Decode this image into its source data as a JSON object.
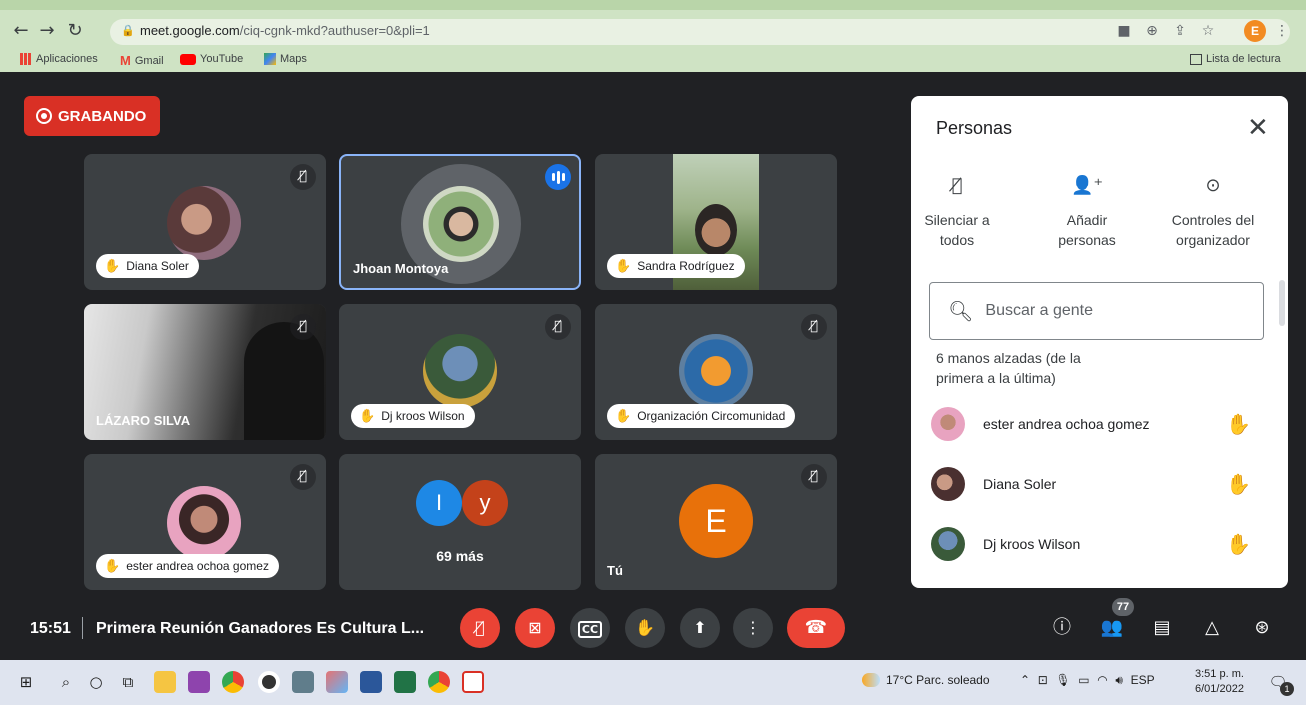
{
  "browser": {
    "url_host": "meet.google.com",
    "url_path": "/ciq-cgnk-mkd?authuser=0&pli=1",
    "profile_initial": "E",
    "bookmarks": [
      "Aplicaciones",
      "Gmail",
      "YouTube",
      "Maps"
    ],
    "reading_list": "Lista de lectura"
  },
  "meet": {
    "recording_label": "GRABANDO",
    "tiles": [
      {
        "name": "Diana Soler",
        "hand": true,
        "muted": true
      },
      {
        "name": "Jhoan Montoya",
        "hand": false,
        "muted": false,
        "speaking": true
      },
      {
        "name": "Sandra Rodríguez",
        "hand": true,
        "muted": false
      },
      {
        "name": "LÁZARO SILVA",
        "hand": false,
        "muted": true
      },
      {
        "name": "Dj kroos Wilson",
        "hand": true,
        "muted": true
      },
      {
        "name": "Organización Circomunidad",
        "hand": true,
        "muted": true
      },
      {
        "name": "ester andrea ochoa gomez",
        "hand": true,
        "muted": true
      },
      {
        "name": "69 más",
        "initials": [
          "I",
          "y"
        ]
      },
      {
        "name": "Tú",
        "initial": "E",
        "muted": true
      }
    ]
  },
  "panel": {
    "title": "Personas",
    "actions": [
      {
        "label_line1": "Silenciar a",
        "label_line2": "todos"
      },
      {
        "label_line1": "Añadir",
        "label_line2": "personas"
      },
      {
        "label_line1": "Controles del",
        "label_line2": "organizador"
      }
    ],
    "search_placeholder": "Buscar a gente",
    "hands_line1": "6 manos alzadas (de la",
    "hands_line2": "primera a la última)",
    "people": [
      "ester andrea ochoa gomez",
      "Diana Soler",
      "Dj kroos Wilson"
    ]
  },
  "bottombar": {
    "time": "15:51",
    "meeting_title": "Primera Reunión Ganadores Es Cultura L...",
    "participants_count": "77"
  },
  "taskbar": {
    "weather": "17°C  Parc. soleado",
    "lang": "ESP",
    "time": "3:51 p. m.",
    "date": "6/01/2022",
    "notif": "1"
  },
  "colors": {
    "meet_bg": "#202124",
    "tile_bg": "#3c4043",
    "red": "#ea4335",
    "blue": "#1a73e8",
    "self_avatar": "#e8710a"
  }
}
